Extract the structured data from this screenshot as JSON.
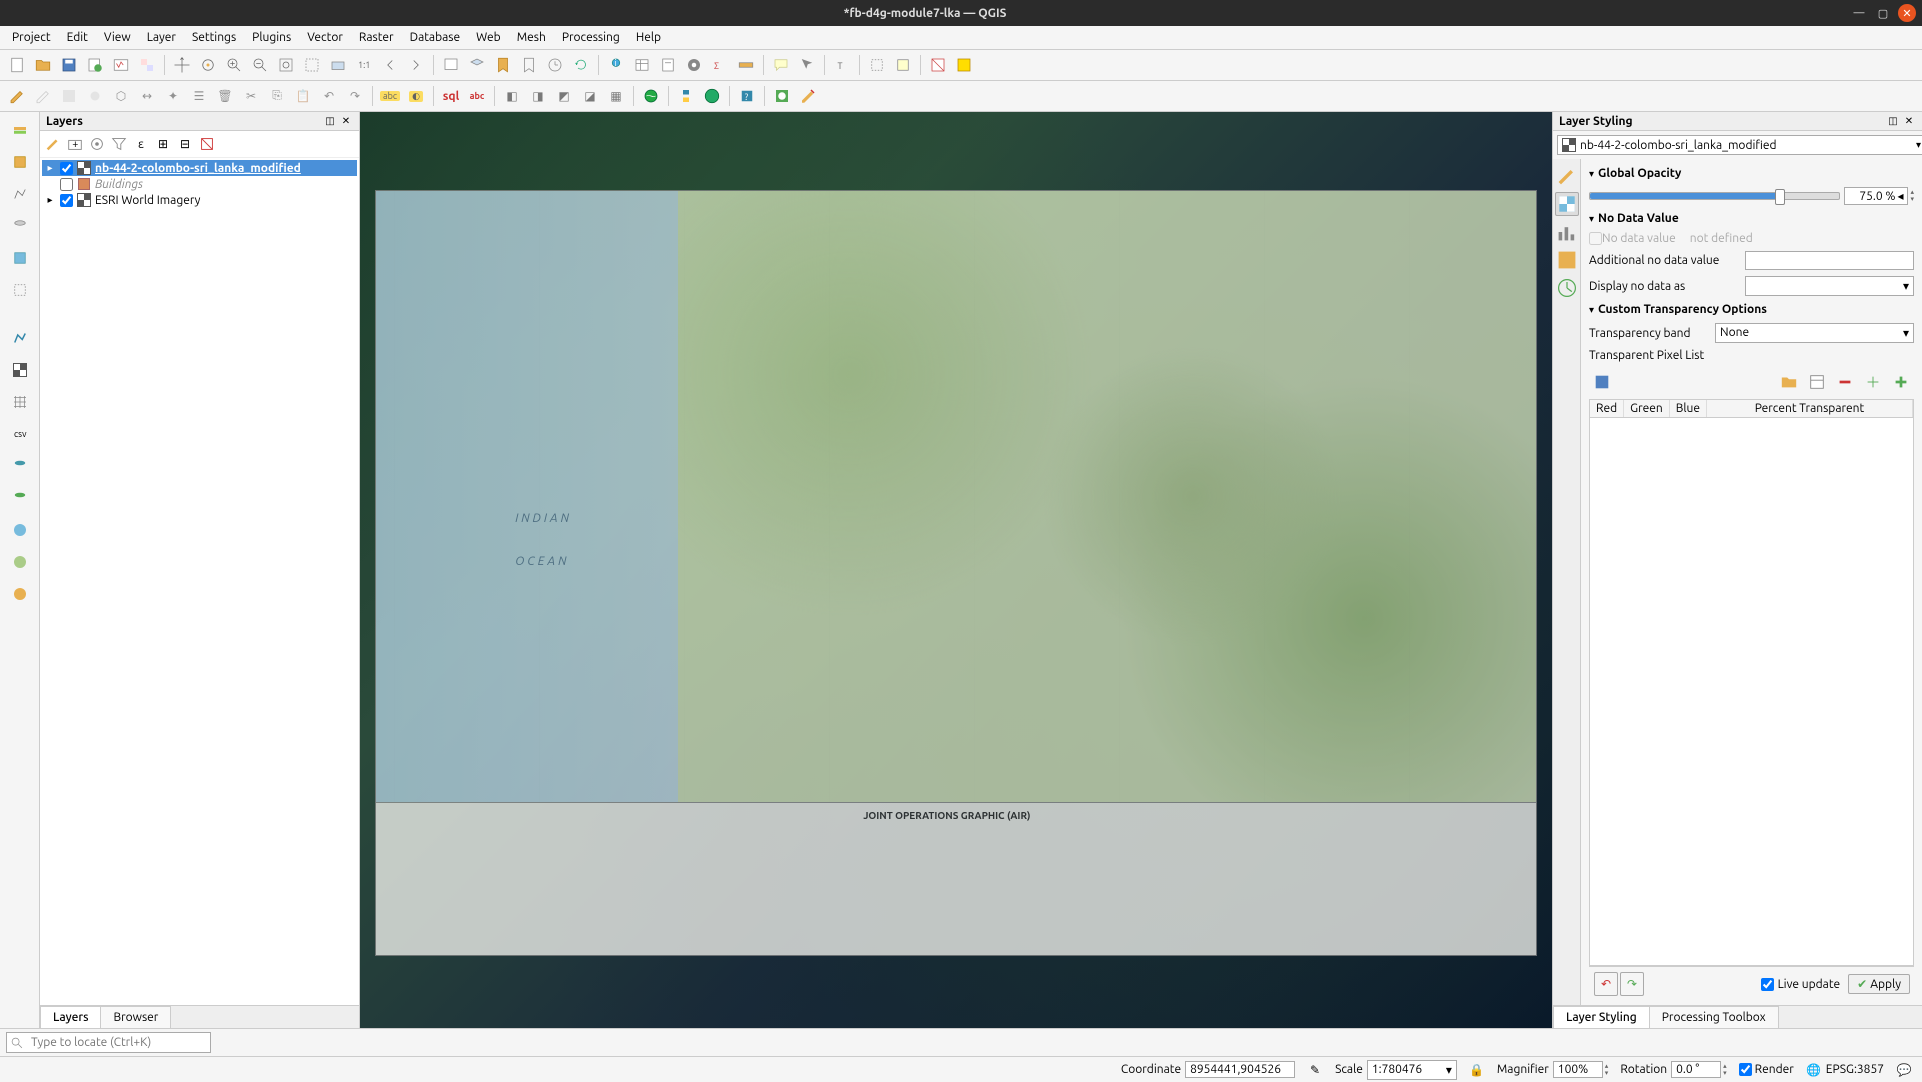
{
  "title": "*fb-d4g-module7-lka — QGIS",
  "menu": [
    "Project",
    "Edit",
    "View",
    "Layer",
    "Settings",
    "Plugins",
    "Vector",
    "Raster",
    "Database",
    "Web",
    "Mesh",
    "Processing",
    "Help"
  ],
  "layers_panel": {
    "title": "Layers",
    "items": [
      {
        "name": "nb-44-2-colombo-sri_lanka_modified",
        "checked": true,
        "selected": true,
        "type": "raster"
      },
      {
        "name": "Buildings",
        "checked": false,
        "selected": false,
        "type": "vector",
        "italic": true
      },
      {
        "name": "ESRI World Imagery",
        "checked": true,
        "selected": false,
        "type": "raster"
      }
    ],
    "tabs": [
      "Layers",
      "Browser"
    ]
  },
  "map": {
    "ocean_label1": "INDIAN",
    "ocean_label2": "OCEAN",
    "chart_title": "JOINT OPERATIONS GRAPHIC (AIR)"
  },
  "styling": {
    "panel_title": "Layer Styling",
    "layer_combo": "nb-44-2-colombo-sri_lanka_modified",
    "global_opacity_label": "Global Opacity",
    "opacity_value": "75.0 %",
    "no_data_section": "No Data Value",
    "no_data_chk": "No data value",
    "no_data_def": "not defined",
    "additional_label": "Additional no data value",
    "display_label": "Display no data as",
    "custom_section": "Custom Transparency Options",
    "trans_band_label": "Transparency band",
    "trans_band_value": "None",
    "pixel_list_label": "Transparent Pixel List",
    "pixel_cols": [
      "Red",
      "Green",
      "Blue",
      "Percent Transparent"
    ],
    "live_update": "Live update",
    "apply": "Apply",
    "tabs": [
      "Layer Styling",
      "Processing Toolbox"
    ]
  },
  "locator_placeholder": "Type to locate (Ctrl+K)",
  "status": {
    "coord_label": "Coordinate",
    "coord_value": "8954441,904526",
    "scale_label": "Scale",
    "scale_value": "1:780476",
    "magnifier_label": "Magnifier",
    "magnifier_value": "100%",
    "rotation_label": "Rotation",
    "rotation_value": "0.0 °",
    "render_label": "Render",
    "crs": "EPSG:3857"
  }
}
